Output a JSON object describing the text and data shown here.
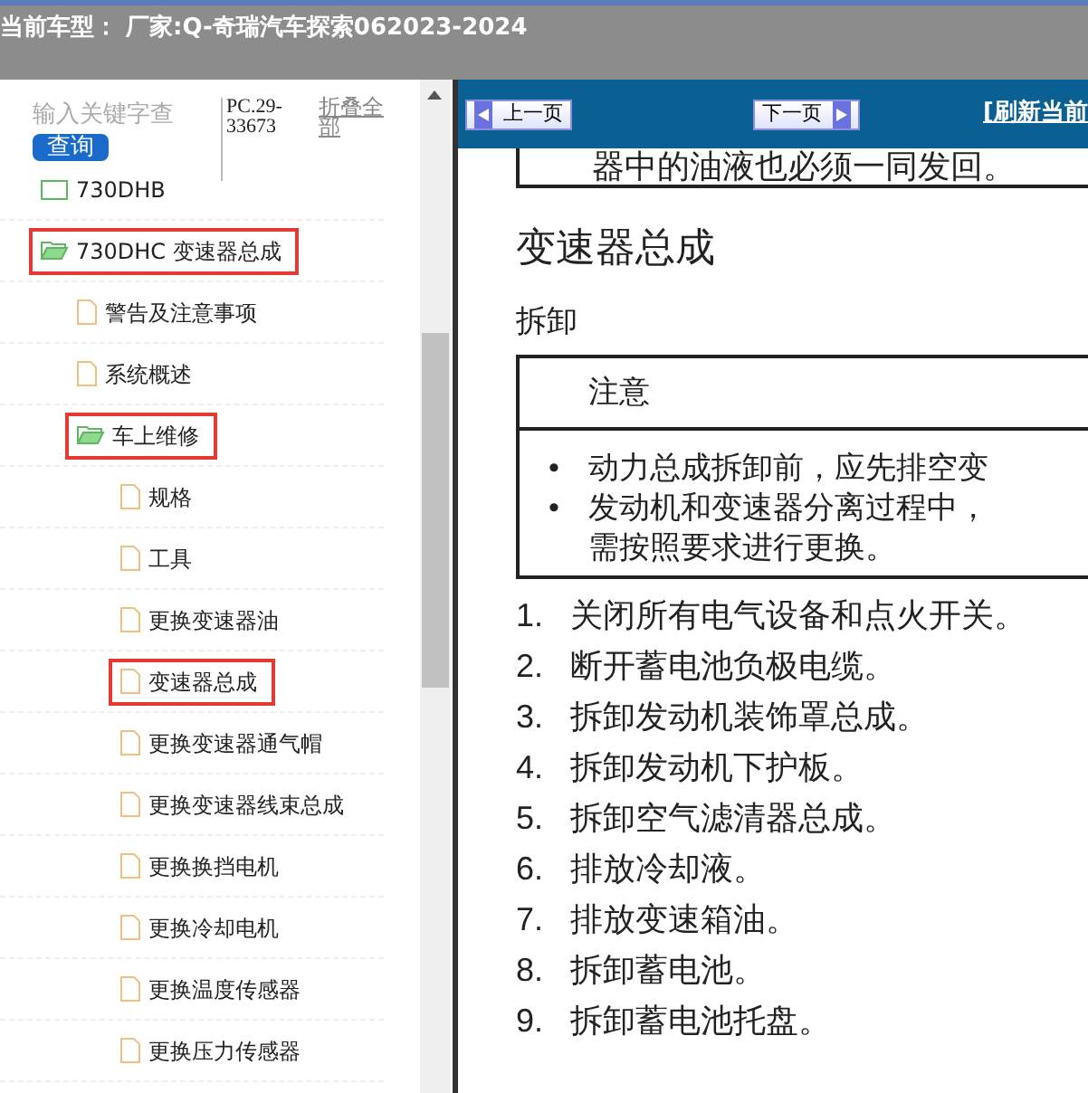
{
  "header": {
    "title": "当前车型： 厂家:Q-奇瑞汽车探索062023-2024"
  },
  "sidebar": {
    "search": {
      "placeholder": "输入关键字查"
    },
    "search_button": "查询",
    "code": "PC.29-33673",
    "collapse_all": "折叠全部",
    "tree": [
      {
        "label": "730DHB",
        "kind": "folder",
        "expanded": false,
        "highlighted": false
      },
      {
        "label": "730DHC 变速器总成",
        "kind": "folder",
        "expanded": true,
        "highlighted": true,
        "children": [
          {
            "label": "警告及注意事项",
            "kind": "page",
            "highlighted": false
          },
          {
            "label": "系统概述",
            "kind": "page",
            "highlighted": false
          },
          {
            "label": "车上维修",
            "kind": "folder",
            "expanded": true,
            "highlighted": true,
            "children": [
              {
                "label": "规格",
                "kind": "page",
                "highlighted": false
              },
              {
                "label": "工具",
                "kind": "page",
                "highlighted": false
              },
              {
                "label": "更换变速器油",
                "kind": "page",
                "highlighted": false
              },
              {
                "label": "变速器总成",
                "kind": "page",
                "highlighted": true
              },
              {
                "label": "更换变速器通气帽",
                "kind": "page",
                "highlighted": false
              },
              {
                "label": "更换变速器线束总成",
                "kind": "page",
                "highlighted": false
              },
              {
                "label": "更换换挡电机",
                "kind": "page",
                "highlighted": false
              },
              {
                "label": "更换冷却电机",
                "kind": "page",
                "highlighted": false
              },
              {
                "label": "更换温度传感器",
                "kind": "page",
                "highlighted": false
              },
              {
                "label": "更换压力传感器",
                "kind": "page",
                "highlighted": false
              }
            ]
          }
        ]
      }
    ]
  },
  "toolbar": {
    "prev_button": "上一页",
    "next_button": "下一页",
    "refresh_link": "[刷新当前"
  },
  "document": {
    "cut_line": "器中的油液也必须一同发回。",
    "title": "变速器总成",
    "subtitle": "拆卸",
    "notice": {
      "heading": "注意",
      "bullets": [
        {
          "marker": "•",
          "text": "动力总成拆卸前，应先排空变"
        },
        {
          "marker": "•",
          "text": "发动机和变速器分离过程中，需按照要求进行更换。"
        }
      ]
    },
    "steps": [
      {
        "number": "1.",
        "text": "关闭所有电气设备和点火开关。"
      },
      {
        "number": "2.",
        "text": "断开蓄电池负极电缆。"
      },
      {
        "number": "3.",
        "text": "拆卸发动机装饰罩总成。"
      },
      {
        "number": "4.",
        "text": "拆卸发动机下护板。"
      },
      {
        "number": "5.",
        "text": "拆卸空气滤清器总成。"
      },
      {
        "number": "6.",
        "text": "排放冷却液。"
      },
      {
        "number": "7.",
        "text": "排放变速箱油。"
      },
      {
        "number": "8.",
        "text": "拆卸蓄电池。"
      },
      {
        "number": "9.",
        "text": "拆卸蓄电池托盘。"
      }
    ]
  }
}
